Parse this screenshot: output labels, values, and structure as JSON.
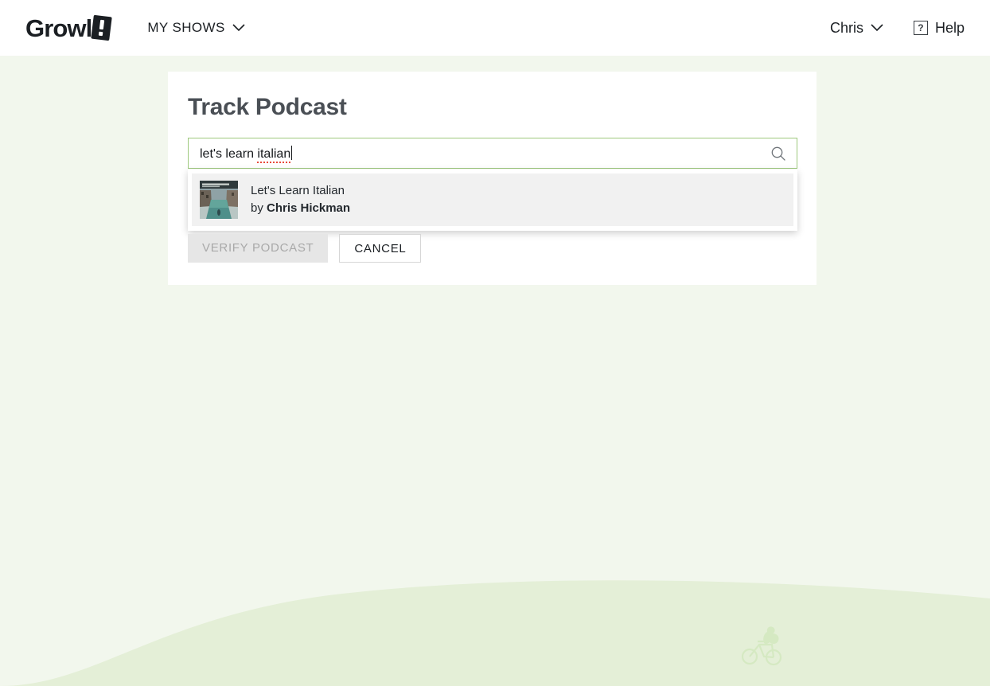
{
  "header": {
    "brand": {
      "word": "Growl",
      "mark": "exclamation-mark-logo"
    },
    "nav": {
      "my_shows_label": "MY SHOWS",
      "chevron": "chevron-down-icon"
    },
    "user": {
      "name": "Chris",
      "chevron": "chevron-down-icon"
    },
    "help": {
      "label": "Help",
      "icon_glyph": "?"
    }
  },
  "card": {
    "title": "Track Podcast",
    "search": {
      "value": "let's learn italian",
      "value_plain": "let's learn ",
      "value_misspelled": "italian",
      "placeholder": "",
      "icon": "search-icon"
    },
    "dropdown": {
      "results": [
        {
          "thumbnail_alt": "Let's Learn Italian podcast cover art showing a Venice canal",
          "title": "Let's Learn Italian",
          "by_prefix": "by ",
          "author": "Chris Hickman"
        }
      ]
    },
    "actions": {
      "verify_label": "VERIFY PODCAST",
      "verify_disabled": true,
      "cancel_label": "CANCEL"
    }
  },
  "decor": {
    "hill": "rolling-green-hill",
    "mascot": "squirrel-on-bicycle-icon"
  },
  "colors": {
    "page_background": "#f2f7ed",
    "hill": "#e4efd7",
    "mascot": "#d5e9c2",
    "accent_border": "#9ec97e",
    "title_text": "#4a4f55",
    "spellcheck_underline": "#e8493a",
    "disabled_button_bg": "#e6e6e6",
    "disabled_button_text": "#a9a9a9"
  }
}
